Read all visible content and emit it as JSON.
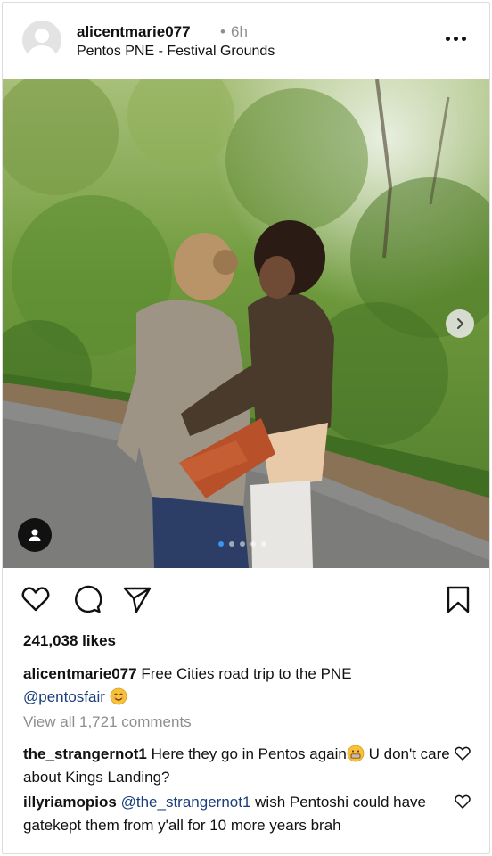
{
  "post": {
    "username": "alicentmarie077",
    "separator": "•",
    "time_ago": "6h",
    "location": "Pentos PNE - Festival Grounds",
    "more_icon": "more-horizontal-icon"
  },
  "media": {
    "description_icon": "photo",
    "carousel_count": 5,
    "carousel_active_index": 0,
    "next_icon": "chevron-right-icon",
    "tag_icon": "user-tag-icon"
  },
  "actions": {
    "like_icon": "heart-icon",
    "comment_icon": "comment-icon",
    "share_icon": "send-icon",
    "save_icon": "bookmark-icon"
  },
  "likes_text": "241,038 likes",
  "caption": {
    "username": "alicentmarie077",
    "text": "Free Cities road trip to the PNE",
    "mention": "@pentosfair",
    "emoji": "smiling-face-emoji"
  },
  "view_all_comments": "View all 1,721 comments",
  "comments": [
    {
      "username": "the_strangernot1",
      "text_before": "Here they go in Pentos again",
      "emoji": "grimacing-face-emoji",
      "text_after": "U don't care about Kings Landing?"
    },
    {
      "username": "illyriamopios",
      "mention": "@the_strangernot1",
      "text": "wish Pentoshi could have gatekept them from y'all for 10 more years brah"
    }
  ],
  "colors": {
    "accent_blue": "#3897f0",
    "mention": "#1a3f7a",
    "secondary_text": "#8e8e8e"
  }
}
